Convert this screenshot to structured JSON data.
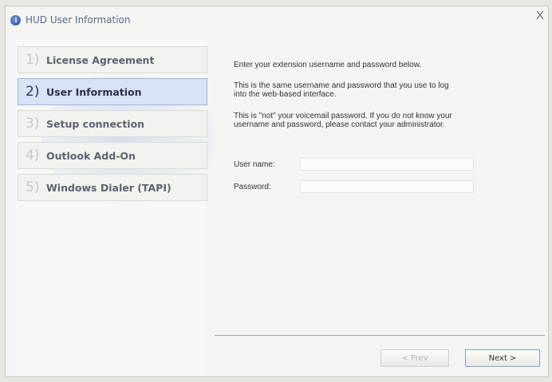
{
  "window": {
    "title": "HUD User Information",
    "close_glyph": "X"
  },
  "steps": [
    {
      "num": "1)",
      "label": "License Agreement"
    },
    {
      "num": "2)",
      "label": "User Information"
    },
    {
      "num": "3)",
      "label": "Setup connection"
    },
    {
      "num": "4)",
      "label": "Outlook Add-On"
    },
    {
      "num": "5)",
      "label": "Windows Dialer (TAPI)"
    }
  ],
  "active_step": 2,
  "content": {
    "intro": "Enter your extension username and password below.",
    "same_note": "This is the same username and password that you use to log into the web-based interface.",
    "voicemail_note": "This is \"not\" your voicemail password. If you do not know your username and password, please contact your administrator.",
    "username_label": "User name:",
    "username_value": "",
    "password_label": "Password:",
    "password_value": ""
  },
  "buttons": {
    "prev": "< Prev",
    "next": "Next >"
  },
  "colors": {
    "active_step_bg": "#d9e3f7",
    "active_step_border": "#9fb3df",
    "app_icon": "#2a4fa8"
  },
  "icons": {
    "app": "info-icon",
    "close": "close-icon"
  }
}
